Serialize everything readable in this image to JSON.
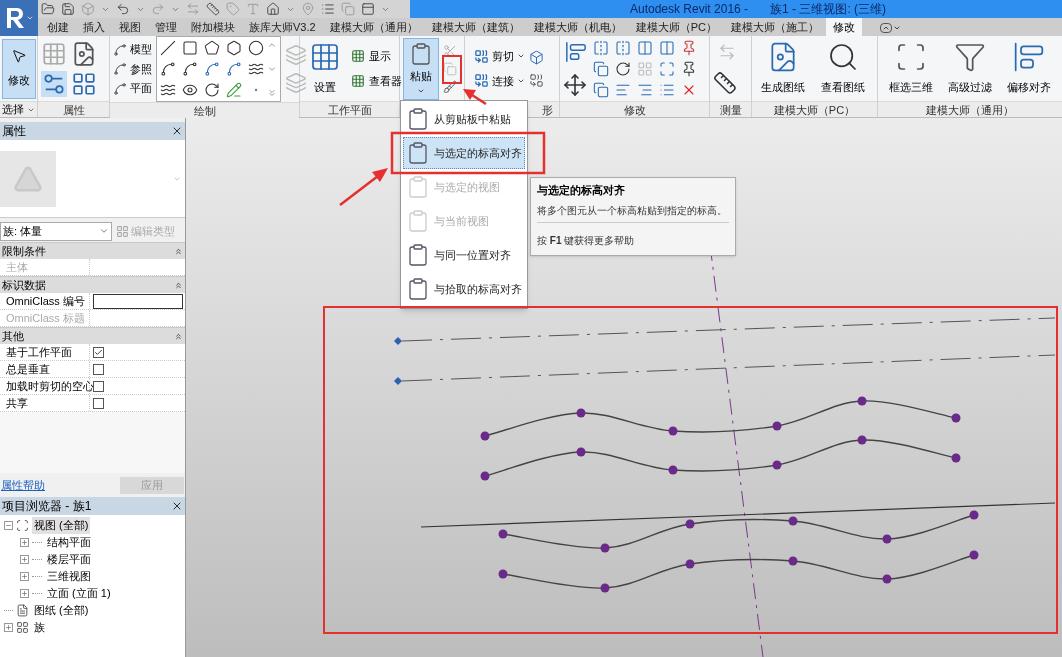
{
  "title_bar": {
    "app": "Autodesk Revit 2016 -",
    "document": "族1 - 三维视图: (三维)"
  },
  "ribbon_tabs": [
    {
      "label": "创建",
      "selected": false
    },
    {
      "label": "插入",
      "selected": false
    },
    {
      "label": "视图",
      "selected": false
    },
    {
      "label": "管理",
      "selected": false
    },
    {
      "label": "附加模块",
      "selected": false
    },
    {
      "label": "族库大师V3.2",
      "selected": false
    },
    {
      "label": "建模大师（通用）",
      "selected": false
    },
    {
      "label": "建模大师（建筑）",
      "selected": false
    },
    {
      "label": "建模大师（机电）",
      "selected": false
    },
    {
      "label": "建模大师（PC）",
      "selected": false
    },
    {
      "label": "建模大师（施工）",
      "selected": false
    },
    {
      "label": "修改",
      "selected": true
    }
  ],
  "ribbon": {
    "select": {
      "button": "修改",
      "selected": true,
      "label": "选择"
    },
    "properties": {
      "label": "属性"
    },
    "draw": {
      "tools": [
        "模型",
        "参照",
        "平面"
      ],
      "label": "绘制"
    },
    "work_plane": {
      "large": "设置",
      "small": [
        "显示",
        "查看器"
      ],
      "label": "工作平面"
    },
    "clipboard": {
      "paste": "粘贴"
    },
    "geometry": {
      "buttons": [
        "剪切",
        "连接"
      ],
      "label": "形"
    },
    "modify": {
      "label": "修改"
    },
    "measure": {
      "label": "测量"
    },
    "pc": {
      "buttons": [
        "生成图纸",
        "查看图纸"
      ],
      "label": "建模大师（PC）"
    },
    "general": {
      "buttons": [
        "框选三维",
        "高级过滤",
        "偏移对齐"
      ],
      "label": "建模大师（通用）"
    }
  },
  "paste_menu": [
    {
      "label": "从剪贴板中粘贴",
      "disabled": false,
      "selected": false
    },
    {
      "label": "与选定的标高对齐",
      "disabled": false,
      "selected": true
    },
    {
      "label": "与选定的视图",
      "disabled": true,
      "selected": false
    },
    {
      "label": "与当前视图",
      "disabled": true,
      "selected": false
    },
    {
      "label": "与同一位置对齐",
      "disabled": false,
      "selected": false
    },
    {
      "label": "与拾取的标高对齐",
      "disabled": false,
      "selected": false
    }
  ],
  "tooltip": {
    "title": "与选定的标高对齐",
    "description": "将多个图元从一个标高粘贴到指定的标高。",
    "help": "按 **F1** 键获得更多帮助"
  },
  "properties": {
    "title": "属性",
    "type_selector": "族: 体量",
    "edit_type": {
      "label": "编辑类型",
      "disabled": true
    },
    "groups": [
      {
        "name": "限制条件",
        "expanded": true,
        "rows": [
          {
            "label": "主体",
            "kind": "text",
            "disabled": true
          }
        ]
      },
      {
        "name": "标识数据",
        "expanded": true,
        "rows": [
          {
            "label": "OmniClass 编号",
            "kind": "field",
            "disabled": false
          },
          {
            "label": "OmniClass 标题",
            "kind": "text",
            "disabled": true
          }
        ]
      },
      {
        "name": "其他",
        "expanded": true,
        "rows": [
          {
            "label": "基于工作平面",
            "kind": "checkbox",
            "checked": true,
            "disabled": false
          },
          {
            "label": "总是垂直",
            "kind": "checkbox",
            "checked": false,
            "disabled": false
          },
          {
            "label": "加载时剪切的空心",
            "kind": "checkbox",
            "checked": false,
            "disabled": false
          },
          {
            "label": "共享",
            "kind": "checkbox",
            "checked": false,
            "disabled": false
          }
        ]
      }
    ],
    "help_link": "属性帮助",
    "apply": {
      "label": "应用",
      "disabled": true
    }
  },
  "project_browser": {
    "title": "项目浏览器 - 族1",
    "tree": [
      {
        "label": "视图 (全部)",
        "kind": "views",
        "expanded": true,
        "selected": true,
        "children": [
          {
            "label": "结构平面",
            "kind": "none",
            "expanded": false,
            "selected": false
          },
          {
            "label": "楼层平面",
            "kind": "none",
            "expanded": false,
            "selected": false
          },
          {
            "label": "三维视图",
            "kind": "none",
            "expanded": false,
            "selected": false
          },
          {
            "label": "立面 (立面 1)",
            "kind": "none",
            "expanded": false,
            "selected": false
          }
        ]
      },
      {
        "label": "图纸 (全部)",
        "kind": "sheets",
        "selected": false
      },
      {
        "label": "族",
        "kind": "families",
        "expanded": false,
        "selected": false
      }
    ]
  }
}
